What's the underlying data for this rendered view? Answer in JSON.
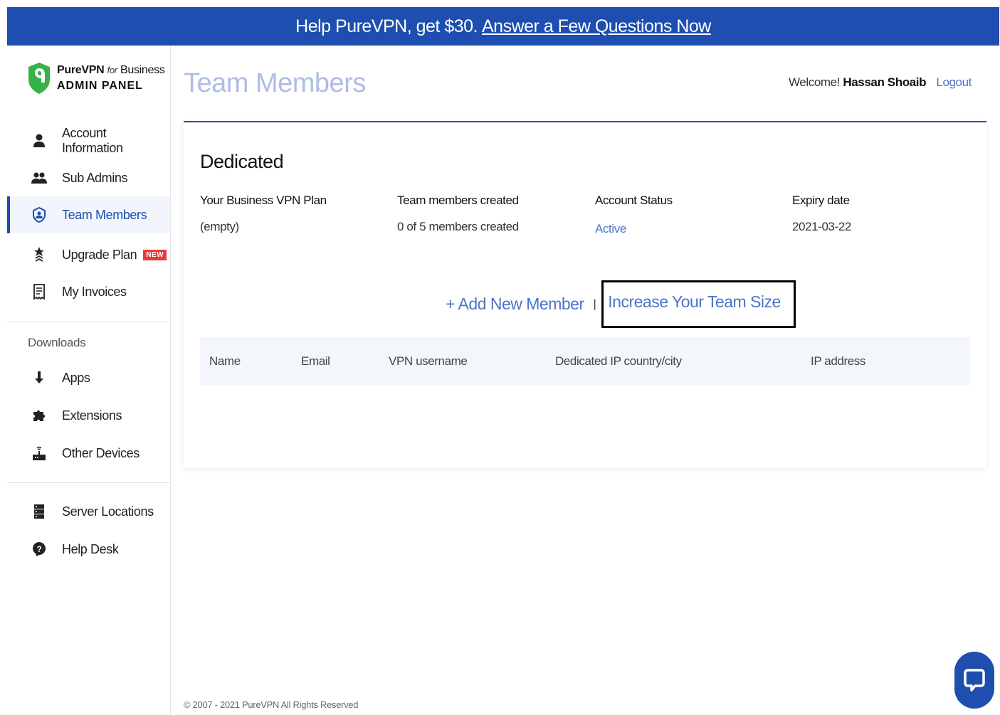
{
  "banner": {
    "text": "Help PureVPN, get $30.",
    "link": "Answer a Few Questions Now"
  },
  "brand": {
    "name": "PureVPN",
    "for": "for",
    "business": "Business",
    "panel": "ADMIN PANEL"
  },
  "nav": {
    "items": [
      {
        "label": "Account Information",
        "icon": "user-icon"
      },
      {
        "label": "Sub Admins",
        "icon": "users-icon"
      },
      {
        "label": "Team Members",
        "icon": "team-icon",
        "active": true
      },
      {
        "label": "Upgrade Plan",
        "icon": "upgrade-icon",
        "badge": "NEW"
      },
      {
        "label": "My Invoices",
        "icon": "invoice-icon"
      }
    ],
    "downloads_label": "Downloads",
    "downloads": [
      {
        "label": "Apps",
        "icon": "arrow-down-icon"
      },
      {
        "label": "Extensions",
        "icon": "puzzle-icon"
      },
      {
        "label": "Other Devices",
        "icon": "router-icon"
      }
    ],
    "bottom": [
      {
        "label": "Server Locations",
        "icon": "server-icon"
      },
      {
        "label": "Help Desk",
        "icon": "help-icon"
      }
    ]
  },
  "header": {
    "title": "Team Members",
    "welcome": "Welcome!",
    "user": "Hassan Shoaib",
    "logout": "Logout"
  },
  "plan": {
    "title": "Dedicated",
    "fields": [
      {
        "label": "Your Business VPN Plan",
        "value": "(empty)"
      },
      {
        "label": "Team members created",
        "value": "0 of 5 members created"
      },
      {
        "label": "Account Status",
        "value": "Active"
      },
      {
        "label": "Expiry date",
        "value": "2021-03-22"
      }
    ]
  },
  "actions": {
    "add": "+ Add New Member",
    "separator": "|",
    "increase": "Increase Your Team Size"
  },
  "table": {
    "columns": [
      "Name",
      "Email",
      "VPN username",
      "Dedicated IP country/city",
      "IP address"
    ]
  },
  "footer": "© 2007 - 2021 PureVPN All Rights Reserved",
  "colors": {
    "brand": "#1e4eb0",
    "link": "#4b74c7",
    "badge": "#e73c3c",
    "logo_green": "#36b24a"
  }
}
